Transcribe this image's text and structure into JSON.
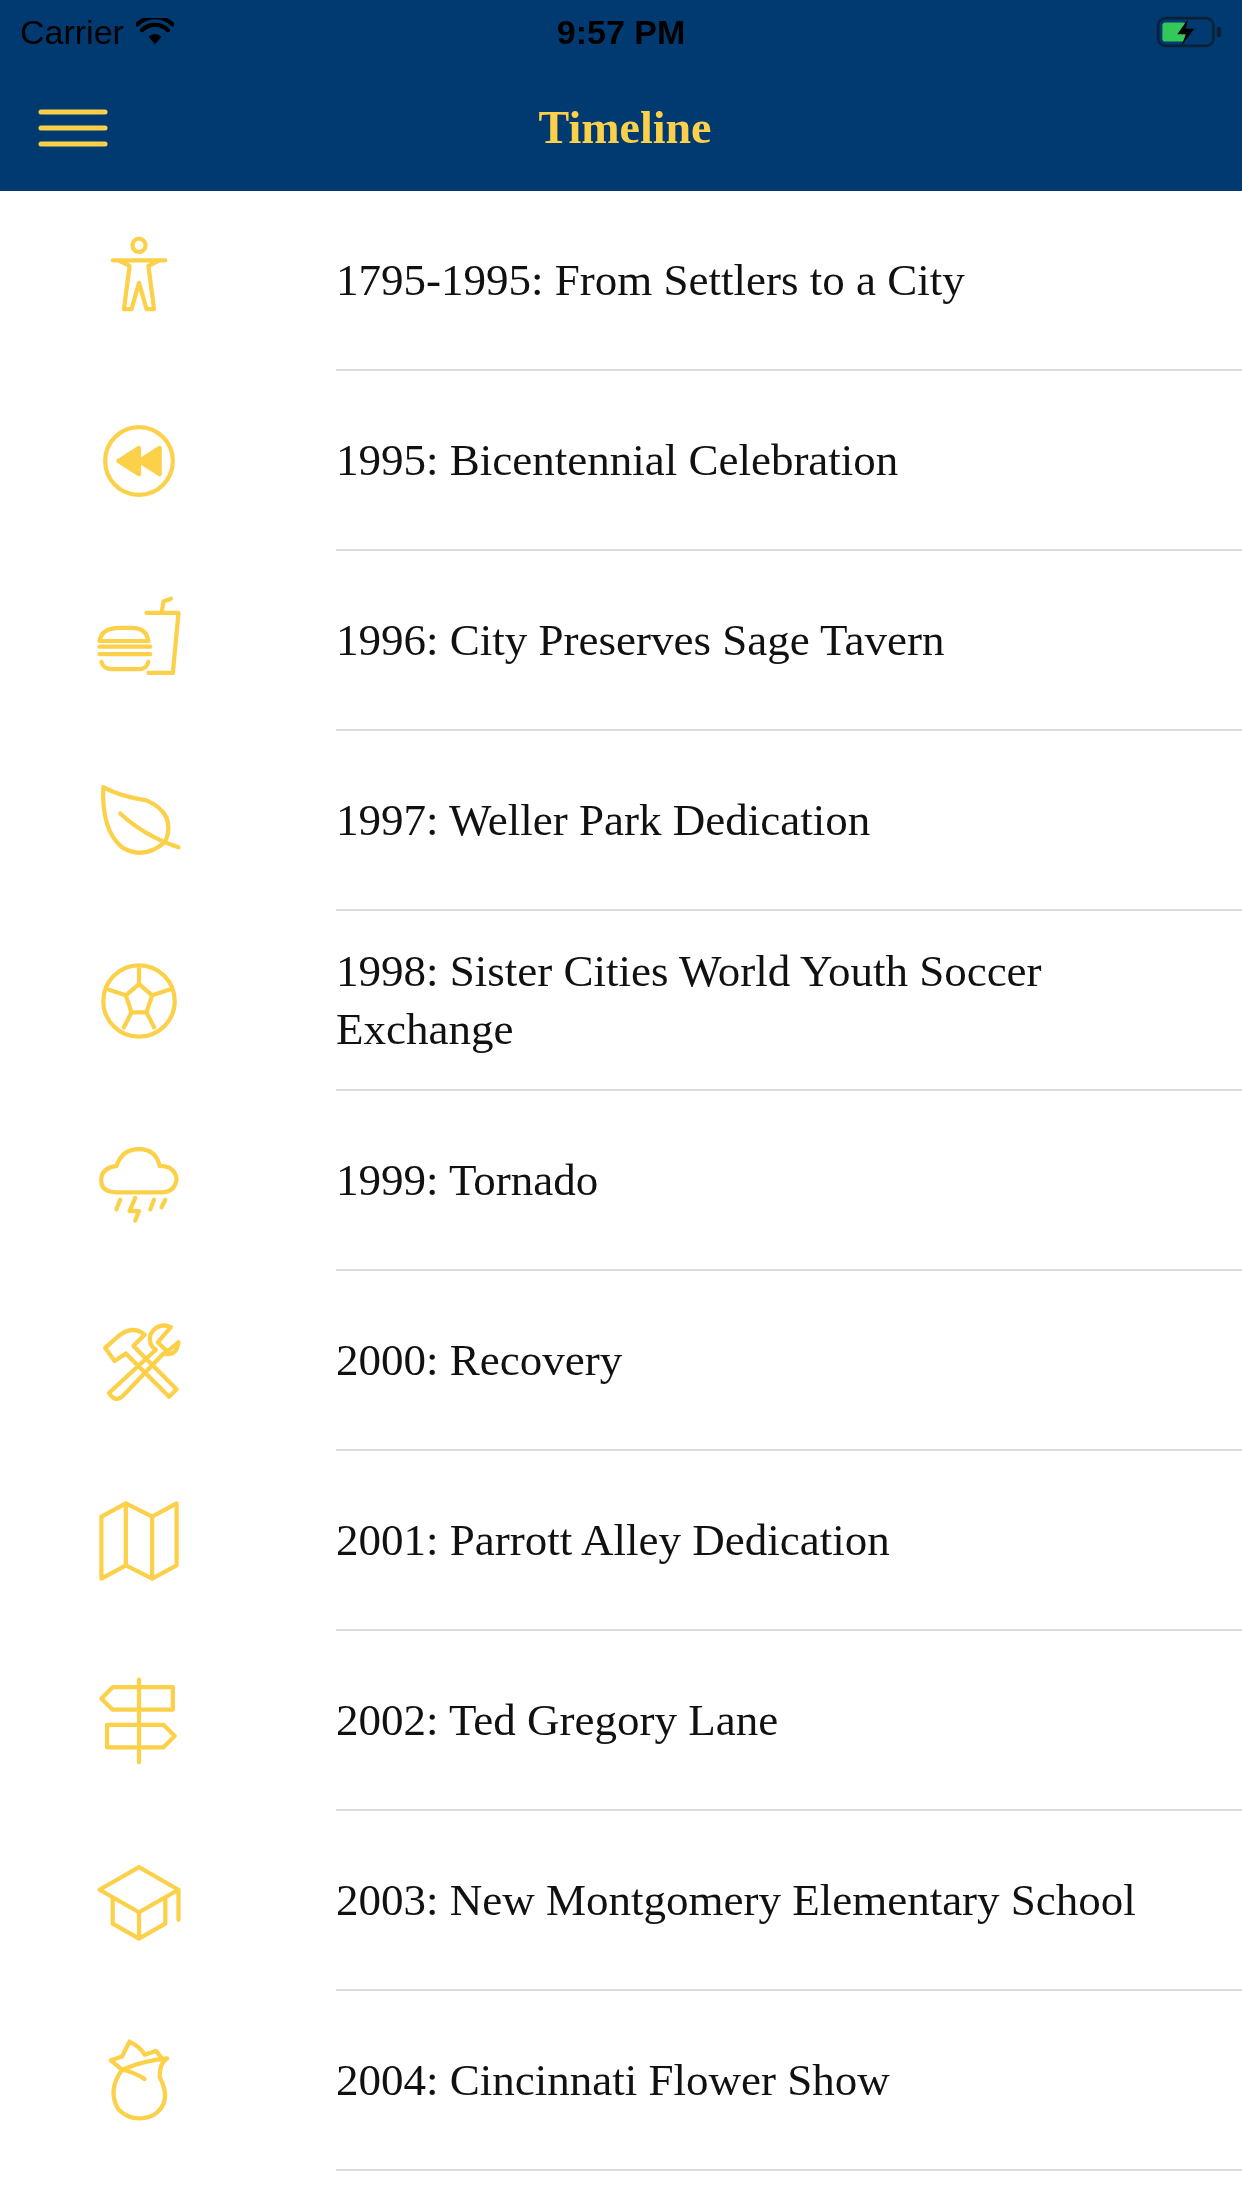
{
  "status_bar": {
    "carrier": "Carrier",
    "time": "9:57 PM",
    "charging": true
  },
  "nav": {
    "title": "Timeline"
  },
  "rows": [
    {
      "title": "1795-1995: From Settlers to a City"
    },
    {
      "title": "1995: Bicentennial Celebration"
    },
    {
      "title": "1996: City Preserves Sage Tavern"
    },
    {
      "title": "1997: Weller Park Dedication"
    },
    {
      "title": "1998: Sister Cities World Youth Soccer Exchange"
    },
    {
      "title": "1999: Tornado"
    },
    {
      "title": "2000: Recovery"
    },
    {
      "title": "2001: Parrott Alley Dedication"
    },
    {
      "title": "2002: Ted Gregory Lane"
    },
    {
      "title": "2003: New Montgomery Elementary School"
    },
    {
      "title": "2004: Cincinnati Flower Show"
    }
  ]
}
